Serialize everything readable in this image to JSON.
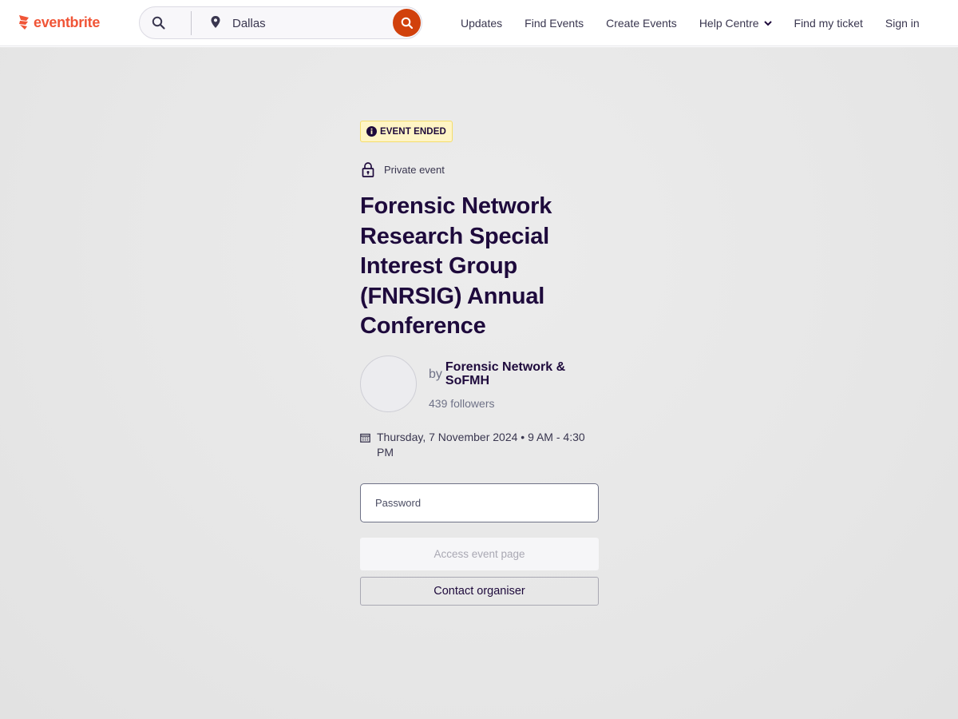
{
  "brand": {
    "name": "eventbrite",
    "accent": "#f05537",
    "search_button_color": "#d1410c"
  },
  "search": {
    "location_value": "Dallas",
    "icons": [
      "search-icon",
      "location-pin-icon",
      "search-submit-icon"
    ]
  },
  "nav": {
    "items": [
      {
        "label": "Updates"
      },
      {
        "label": "Find Events"
      },
      {
        "label": "Create Events"
      },
      {
        "label": "Help Centre",
        "icon": "chevron-down-icon"
      },
      {
        "label": "Find my ticket"
      },
      {
        "label": "Sign in"
      }
    ]
  },
  "event": {
    "status_badge": "EVENT ENDED",
    "status_badge_icon": "info-icon",
    "privacy_label": "Private event",
    "privacy_icon": "lock-icon",
    "title": "Forensic Network Research Special Interest Group (FNRSIG) Annual Conference",
    "organiser": {
      "by": "by",
      "name": "Forensic Network & SoFMH",
      "followers": "439 followers"
    },
    "date": {
      "icon": "calendar-icon",
      "text": "Thursday, 7 November 2024  •  9 AM - 4:30 PM"
    }
  },
  "form": {
    "password_placeholder": "Password",
    "access_button": "Access event page",
    "contact_button": "Contact organiser"
  }
}
